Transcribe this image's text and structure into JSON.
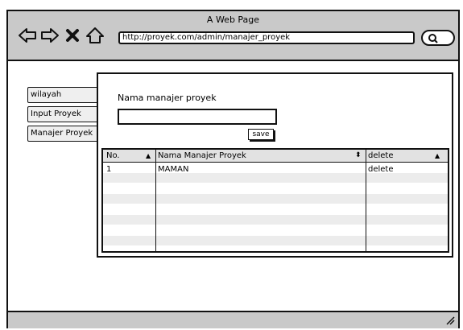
{
  "window": {
    "title": "A Web Page",
    "url": "http://proyek.com/admin/manajer_proyek"
  },
  "sidebar": {
    "items": [
      {
        "label": "wilayah"
      },
      {
        "label": "Input Proyek"
      },
      {
        "label": "Manajer Proyek"
      }
    ]
  },
  "form": {
    "label": "Nama manajer proyek",
    "value": "",
    "save_label": "save"
  },
  "table": {
    "columns": [
      "No.",
      "Nama Manajer Proyek",
      "delete"
    ],
    "rows": [
      {
        "no": "1",
        "nama": "MAMAN",
        "action": "delete"
      }
    ]
  }
}
